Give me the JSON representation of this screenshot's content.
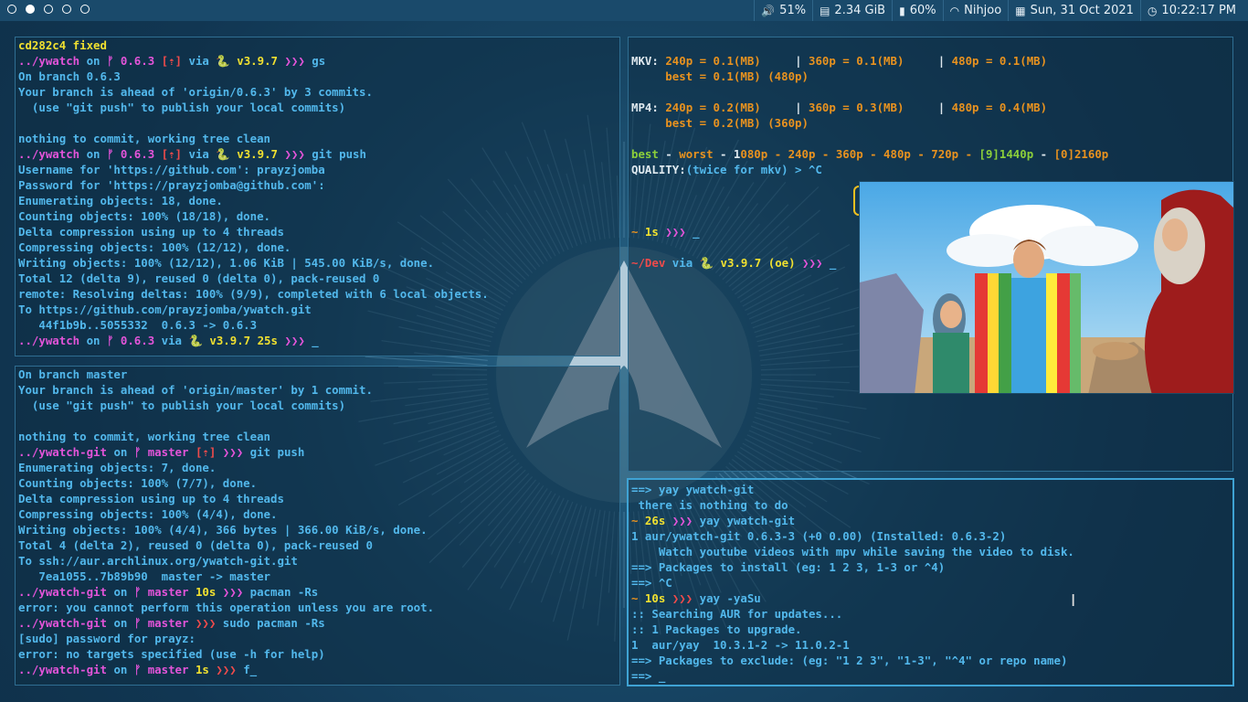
{
  "topbar": {
    "workspaces": [
      {
        "name": "ws1",
        "active": false
      },
      {
        "name": "ws2",
        "active": true
      },
      {
        "name": "ws3",
        "active": false
      },
      {
        "name": "ws4",
        "active": false
      },
      {
        "name": "ws5",
        "active": false
      }
    ],
    "volume": {
      "icon": "speaker-icon",
      "value": "51%"
    },
    "memory": {
      "icon": "ram-icon",
      "value": "2.34 GiB"
    },
    "battery": {
      "icon": "battery-icon",
      "value": "60%"
    },
    "wifi": {
      "icon": "wifi-icon",
      "value": "Nihjoo"
    },
    "date": {
      "icon": "calendar-icon",
      "value": "Sun, 31 Oct 2021"
    },
    "time": {
      "icon": "clock-icon",
      "value": "10:22:17 PM"
    }
  },
  "colors": {
    "default": "#52b8ec",
    "pink": "#e354d9",
    "yellow": "#f0e030",
    "orange": "#e8921f",
    "green": "#8ccf3a",
    "red": "#ef4b4b",
    "white": "#dfe9ef",
    "light": "#cfe7f5"
  },
  "terminals": {
    "top_left": [
      [
        [
          "cd282c4 fixed",
          "yel"
        ]
      ],
      [
        [
          "../ywatch",
          "pink"
        ],
        [
          " on ",
          "def"
        ],
        [
          "ᚠ 0.6.3 ",
          "pink"
        ],
        [
          "[⇡]",
          "red"
        ],
        [
          " via ",
          "def"
        ],
        [
          "🐍 v3.9.7 ",
          "yel"
        ],
        [
          "❯❯❯ ",
          "pink"
        ],
        [
          "gs",
          "def"
        ]
      ],
      [
        [
          "On branch 0.6.3",
          "def"
        ]
      ],
      [
        [
          "Your branch is ahead of 'origin/0.6.3' by 3 commits.",
          "def"
        ]
      ],
      [
        [
          "  (use \"git push\" to publish your local commits)",
          "def"
        ]
      ],
      [
        [
          "",
          "def"
        ]
      ],
      [
        [
          "nothing to commit, working tree clean",
          "def"
        ]
      ],
      [
        [
          "../ywatch",
          "pink"
        ],
        [
          " on ",
          "def"
        ],
        [
          "ᚠ 0.6.3 ",
          "pink"
        ],
        [
          "[⇡]",
          "red"
        ],
        [
          " via ",
          "def"
        ],
        [
          "🐍 v3.9.7 ",
          "yel"
        ],
        [
          "❯❯❯ ",
          "pink"
        ],
        [
          "git push",
          "def"
        ]
      ],
      [
        [
          "Username for 'https://github.com': prayzjomba",
          "def"
        ]
      ],
      [
        [
          "Password for 'https://prayzjomba@github.com':",
          "def"
        ]
      ],
      [
        [
          "Enumerating objects: 18, done.",
          "def"
        ]
      ],
      [
        [
          "Counting objects: 100% (18/18), done.",
          "def"
        ]
      ],
      [
        [
          "Delta compression using up to 4 threads",
          "def"
        ]
      ],
      [
        [
          "Compressing objects: 100% (12/12), done.",
          "def"
        ]
      ],
      [
        [
          "Writing objects: 100% (12/12), 1.06 KiB | 545.00 KiB/s, done.",
          "def"
        ]
      ],
      [
        [
          "Total 12 (delta 9), reused 0 (delta 0), pack-reused 0",
          "def"
        ]
      ],
      [
        [
          "remote: Resolving deltas: 100% (9/9), completed with 6 local objects.",
          "def"
        ]
      ],
      [
        [
          "To https://github.com/prayzjomba/ywatch.git",
          "def"
        ]
      ],
      [
        [
          "   44f1b9b..5055332  0.6.3 -> 0.6.3",
          "def"
        ]
      ],
      [
        [
          "../ywatch",
          "pink"
        ],
        [
          " on ",
          "def"
        ],
        [
          "ᚠ 0.6.3 ",
          "pink"
        ],
        [
          "via ",
          "def"
        ],
        [
          "🐍 v3.9.7 ",
          "yel"
        ],
        [
          "25s ",
          "yel"
        ],
        [
          "❯❯❯ ",
          "pink"
        ],
        [
          "_",
          "def"
        ]
      ]
    ],
    "bottom_left": [
      [
        [
          "On branch master",
          "def"
        ]
      ],
      [
        [
          "Your branch is ahead of 'origin/master' by 1 commit.",
          "def"
        ]
      ],
      [
        [
          "  (use \"git push\" to publish your local commits)",
          "def"
        ]
      ],
      [
        [
          "",
          "def"
        ]
      ],
      [
        [
          "nothing to commit, working tree clean",
          "def"
        ]
      ],
      [
        [
          "../ywatch-git",
          "pink"
        ],
        [
          " on ",
          "def"
        ],
        [
          "ᚠ master ",
          "pink"
        ],
        [
          "[⇡] ",
          "red"
        ],
        [
          "❯❯❯ ",
          "pink"
        ],
        [
          "git push",
          "def"
        ]
      ],
      [
        [
          "Enumerating objects: 7, done.",
          "def"
        ]
      ],
      [
        [
          "Counting objects: 100% (7/7), done.",
          "def"
        ]
      ],
      [
        [
          "Delta compression using up to 4 threads",
          "def"
        ]
      ],
      [
        [
          "Compressing objects: 100% (4/4), done.",
          "def"
        ]
      ],
      [
        [
          "Writing objects: 100% (4/4), 366 bytes | 366.00 KiB/s, done.",
          "def"
        ]
      ],
      [
        [
          "Total 4 (delta 2), reused 0 (delta 0), pack-reused 0",
          "def"
        ]
      ],
      [
        [
          "To ssh://aur.archlinux.org/ywatch-git.git",
          "def"
        ]
      ],
      [
        [
          "   7ea1055..7b89b90  master -> master",
          "def"
        ]
      ],
      [
        [
          "../ywatch-git",
          "pink"
        ],
        [
          " on ",
          "def"
        ],
        [
          "ᚠ master ",
          "pink"
        ],
        [
          "10s ",
          "yel"
        ],
        [
          "❯❯❯ ",
          "pink"
        ],
        [
          "pacman -Rs",
          "def"
        ]
      ],
      [
        [
          "error: you cannot perform this operation unless you are root.",
          "def"
        ]
      ],
      [
        [
          "../ywatch-git",
          "pink"
        ],
        [
          " on ",
          "def"
        ],
        [
          "ᚠ master ",
          "pink"
        ],
        [
          "❯❯❯ ",
          "red"
        ],
        [
          "sudo pacman -Rs",
          "def"
        ]
      ],
      [
        [
          "[sudo] password for prayz:",
          "def"
        ]
      ],
      [
        [
          "error: no targets specified (use -h for help)",
          "def"
        ]
      ],
      [
        [
          "../ywatch-git",
          "pink"
        ],
        [
          " on ",
          "def"
        ],
        [
          "ᚠ master ",
          "pink"
        ],
        [
          "1s ",
          "yel"
        ],
        [
          "❯❯❯ ",
          "red"
        ],
        [
          "f_",
          "def"
        ]
      ]
    ],
    "top_right": [
      [
        [
          "",
          "def"
        ]
      ],
      [
        [
          "MKV: ",
          "wht"
        ],
        [
          "240p = 0.1(MB)     ",
          "org"
        ],
        [
          "| ",
          "wht"
        ],
        [
          "360p = 0.1(MB)     ",
          "org"
        ],
        [
          "| ",
          "wht"
        ],
        [
          "480p = 0.1(MB)",
          "org"
        ]
      ],
      [
        [
          "     best = 0.1(MB) (480p)",
          "org"
        ]
      ],
      [
        [
          "",
          "def"
        ]
      ],
      [
        [
          "MP4: ",
          "wht"
        ],
        [
          "240p = 0.2(MB)     ",
          "org"
        ],
        [
          "| ",
          "wht"
        ],
        [
          "360p = 0.3(MB)     ",
          "org"
        ],
        [
          "| ",
          "wht"
        ],
        [
          "480p = 0.4(MB)",
          "org"
        ]
      ],
      [
        [
          "     best = 0.2(MB) (360p)",
          "org"
        ]
      ],
      [
        [
          "",
          "def"
        ]
      ],
      [
        [
          "best",
          "grn"
        ],
        [
          " - ",
          "wht"
        ],
        [
          "worst",
          "org"
        ],
        [
          " - 1",
          "wht"
        ],
        [
          "080p",
          "org"
        ],
        [
          " - 240p - 360p - 480p - 720p - ",
          "org"
        ],
        [
          "[9]1440p",
          "grn"
        ],
        [
          " - ",
          "wht"
        ],
        [
          "[0]2160p",
          "org"
        ]
      ],
      [
        [
          "QUALITY:",
          "wht"
        ],
        [
          "(twice for mkv) > ^C",
          "def"
        ]
      ],
      [
        [
          "",
          "def"
        ]
      ],
      [
        [
          "",
          "def"
        ]
      ],
      [
        [
          "",
          "def"
        ]
      ],
      [
        [
          "~ ",
          "org"
        ],
        [
          "1s ",
          "yel"
        ],
        [
          "❯❯❯ ",
          "pink"
        ],
        [
          "_",
          "def"
        ]
      ],
      [
        [
          "",
          "def"
        ]
      ],
      [
        [
          "~/Dev",
          "red"
        ],
        [
          " via ",
          "def"
        ],
        [
          "🐍 v3.9.7 ",
          "yel"
        ],
        [
          "(oe) ",
          "yel"
        ],
        [
          "❯❯❯ ",
          "pink"
        ],
        [
          "_",
          "def"
        ]
      ]
    ],
    "bottom_right": [
      [
        [
          "==> yay ywatch-git",
          "def"
        ]
      ],
      [
        [
          " there is nothing to do",
          "def"
        ]
      ],
      [
        [
          "~ ",
          "org"
        ],
        [
          "26s ",
          "yel"
        ],
        [
          "❯❯❯ ",
          "pink"
        ],
        [
          "yay ywatch-git",
          "def"
        ]
      ],
      [
        [
          "1 aur/ywatch-git 0.6.3-3 (+0 0.00) (Installed: 0.6.3-2)",
          "def"
        ]
      ],
      [
        [
          "    Watch youtube videos with mpv while saving the video to disk.",
          "def"
        ]
      ],
      [
        [
          "==> Packages to install (eg: 1 2 3, 1-3 or ^4)",
          "def"
        ]
      ],
      [
        [
          "==> ^C",
          "def"
        ]
      ],
      [
        [
          "~ ",
          "org"
        ],
        [
          "10s ",
          "yel"
        ],
        [
          "❯❯❯ ",
          "red"
        ],
        [
          "yay -yaSu",
          "def"
        ]
      ],
      [
        [
          ":: Searching AUR for updates...",
          "def"
        ]
      ],
      [
        [
          ":: 1 Packages to upgrade.",
          "def"
        ]
      ],
      [
        [
          "1  aur/yay  10.3.1-2 -> 11.0.2-1",
          "def"
        ]
      ],
      [
        [
          "==> Packages to exclude: (eg: \"1 2 3\", \"1-3\", \"^4\" or repo name)",
          "def"
        ]
      ],
      [
        [
          "==> _",
          "def"
        ]
      ]
    ]
  },
  "video": {
    "description": "cartoon-scene"
  }
}
